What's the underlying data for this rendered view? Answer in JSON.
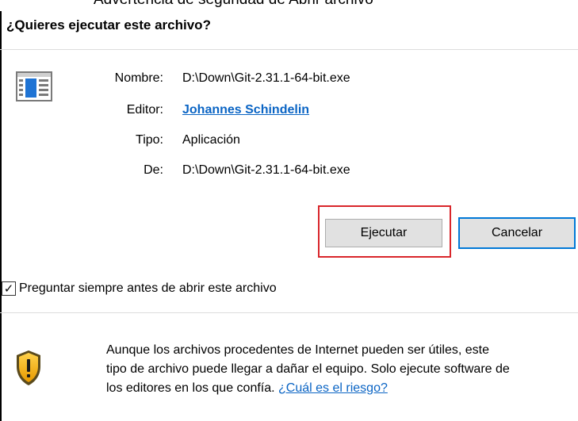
{
  "window": {
    "top_title_fragment": "Advertencia de seguridad de Abrir archivo"
  },
  "dialog": {
    "question": "¿Quieres ejecutar este archivo?",
    "fields": {
      "name_label": "Nombre:",
      "name_value": "D:\\Down\\Git-2.31.1-64-bit.exe",
      "publisher_label": "Editor:",
      "publisher_value": "Johannes Schindelin",
      "type_label": "Tipo:",
      "type_value": "Aplicación",
      "from_label": "De:",
      "from_value": "D:\\Down\\Git-2.31.1-64-bit.exe"
    },
    "buttons": {
      "run": "Ejecutar",
      "cancel": "Cancelar"
    },
    "checkbox": {
      "label": "Preguntar siempre antes de abrir este archivo",
      "checked": true,
      "mark": "✓"
    },
    "warning": {
      "line1": "Aunque los archivos procedentes de Internet pueden ser útiles, este",
      "line2": "tipo de archivo puede llegar a dañar el equipo. Solo ejecute software de",
      "line3_prefix": "los editores en los que confía. ",
      "risk_link": "¿Cuál es el riesgo?"
    },
    "icons": {
      "file": "application-file-icon",
      "shield": "security-shield-warning-icon"
    },
    "colors": {
      "link": "#0a64c4",
      "highlight": "#d9262b",
      "focus_border": "#0078d7"
    }
  }
}
